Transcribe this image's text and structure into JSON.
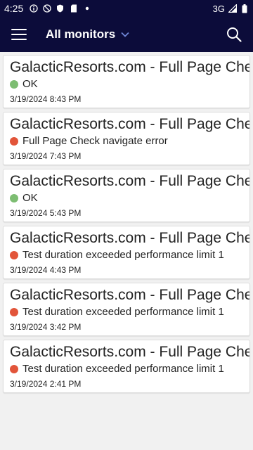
{
  "status_bar": {
    "time": "4:25",
    "network": "3G",
    "icons": [
      "info-icon",
      "block-icon",
      "shield-icon",
      "sd-card-icon",
      "notification-dot-icon",
      "signal-icon",
      "battery-icon"
    ]
  },
  "app_bar": {
    "title": "All monitors",
    "icons": [
      "menu-icon",
      "chevron-down-icon",
      "search-icon"
    ]
  },
  "colors": {
    "header_bg": "#0c0c3a",
    "ok": "#7dbd72",
    "error": "#e2553a"
  },
  "monitors": [
    {
      "title": "GalacticResorts.com - Full Page Check",
      "status": "OK",
      "state": "ok",
      "time": "3/19/2024 8:43 PM"
    },
    {
      "title": "GalacticResorts.com - Full Page Check",
      "status": "Full Page Check navigate error",
      "state": "error",
      "time": "3/19/2024 7:43 PM"
    },
    {
      "title": "GalacticResorts.com - Full Page Check",
      "status": "OK",
      "state": "ok",
      "time": "3/19/2024 5:43 PM"
    },
    {
      "title": "GalacticResorts.com - Full Page Check",
      "status": "Test duration exceeded performance limit 1",
      "state": "error",
      "time": "3/19/2024 4:43 PM"
    },
    {
      "title": "GalacticResorts.com - Full Page Check",
      "status": "Test duration exceeded performance limit 1",
      "state": "error",
      "time": "3/19/2024 3:42 PM"
    },
    {
      "title": "GalacticResorts.com - Full Page Check",
      "status": "Test duration exceeded performance limit 1",
      "state": "error",
      "time": "3/19/2024 2:41 PM"
    }
  ]
}
